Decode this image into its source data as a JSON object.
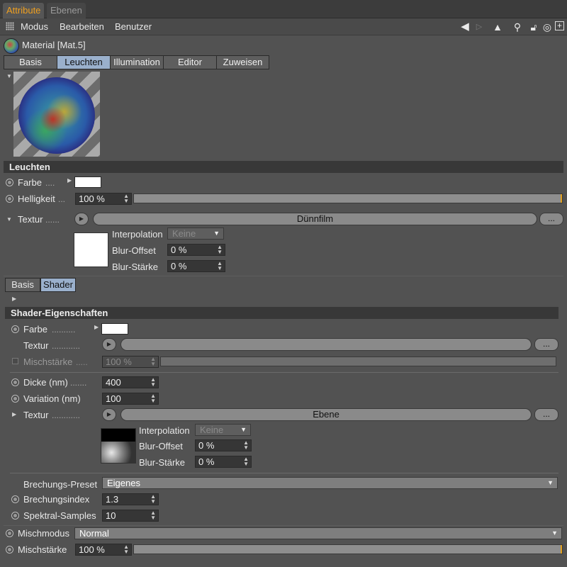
{
  "panel_tabs": [
    "Attribute",
    "Ebenen"
  ],
  "menu": [
    "Modus",
    "Bearbeiten",
    "Benutzer"
  ],
  "toolbar_icons": [
    "back-arrow-icon",
    "forward-arrow-icon",
    "cursor-arrow-icon",
    "search-icon",
    "lock-icon",
    "target-icon",
    "new-panel-icon"
  ],
  "material": {
    "title": "Material [Mat.5]",
    "tabs": [
      "Basis",
      "Leuchten",
      "Illumination",
      "Editor",
      "Zuweisen"
    ],
    "active_tab": "Leuchten"
  },
  "leuchten": {
    "header": "Leuchten",
    "farbe_label": "Farbe",
    "farbe_dots": "....",
    "farbe_color": "#ffffff",
    "helligkeit_label": "Helligkeit",
    "helligkeit_dots": "...",
    "helligkeit_value": "100 %",
    "helligkeit_fraction": 1.0,
    "textur_label": "Textur",
    "textur_dots": "......",
    "textur_shader": "Dünnfilm",
    "more_label": "...",
    "interpolation_label": "Interpolation",
    "interpolation_value": "Keine",
    "blur_offset_label": "Blur-Offset",
    "blur_offset_value": "0 %",
    "blur_staerke_label": "Blur-Stärke",
    "blur_staerke_value": "0 %"
  },
  "shader_tabs": [
    "Basis",
    "Shader"
  ],
  "shader": {
    "header": "Shader-Eigenschaften",
    "farbe_label": "Farbe",
    "farbe_dots": "..........",
    "farbe_color": "#ffffff",
    "textur_label": "Textur",
    "textur_dots": "............",
    "mischstaerke_label": "Mischstärke",
    "mischstaerke_dots": ".....",
    "mischstaerke_value": "100 %",
    "mischstaerke_fraction": 1.0,
    "dicke_label": "Dicke (nm)",
    "dicke_dots": ".......",
    "dicke_value": "400",
    "variation_label": "Variation (nm)",
    "variation_value": "100",
    "textur2_label": "Textur",
    "textur2_dots": "............",
    "textur2_shader": "Ebene",
    "interpolation_label": "Interpolation",
    "interpolation_value": "Keine",
    "blur_offset_label": "Blur-Offset",
    "blur_offset_value": "0 %",
    "blur_staerke_label": "Blur-Stärke",
    "blur_staerke_value": "0 %",
    "brechungs_preset_label": "Brechungs-Preset",
    "brechungs_preset_value": "Eigenes",
    "brechungsindex_label": "Brechungsindex",
    "brechungsindex_value": "1.3",
    "spektral_label": "Spektral-Samples",
    "spektral_value": "10"
  },
  "bottom": {
    "mischmodus_label": "Mischmodus",
    "mischmodus_value": "Normal",
    "mischstaerke_label": "Mischstärke",
    "mischstaerke_value": "100 %",
    "mischstaerke_fraction": 1.0
  }
}
